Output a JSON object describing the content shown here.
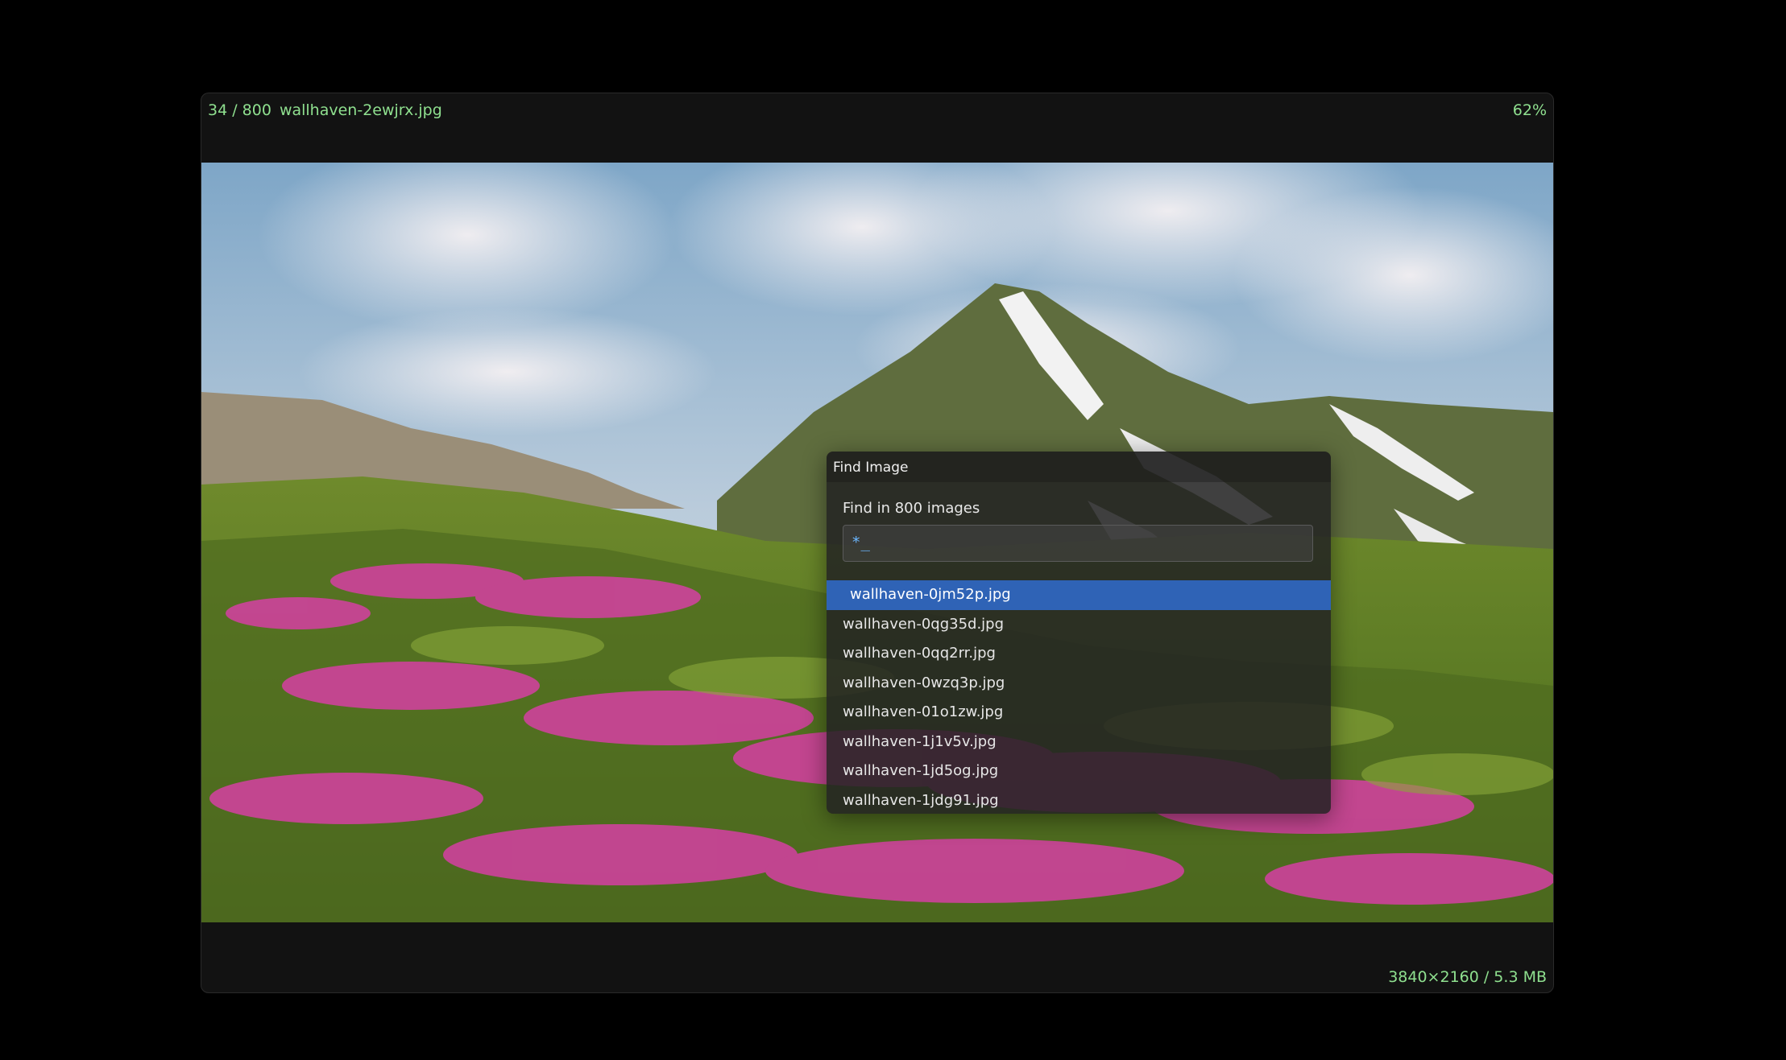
{
  "viewer": {
    "position": "34 / 800",
    "filename": "wallhaven-2ewjrx.jpg",
    "zoom": "62%",
    "image_info": "3840×2160 / 5.3 MB"
  },
  "dialog": {
    "title": "Find Image",
    "label": "Find in 800 images",
    "query": "*_",
    "results": [
      "wallhaven-0jm52p.jpg",
      "wallhaven-0qg35d.jpg",
      "wallhaven-0qq2rr.jpg",
      "wallhaven-0wzq3p.jpg",
      "wallhaven-01o1zw.jpg",
      "wallhaven-1j1v5v.jpg",
      "wallhaven-1jd5og.jpg",
      "wallhaven-1jdg91.jpg"
    ],
    "selected_index": 0
  },
  "colors": {
    "info_text": "#8fe08f",
    "selection": "#2f63b6",
    "query_text": "#6bb7ff"
  }
}
